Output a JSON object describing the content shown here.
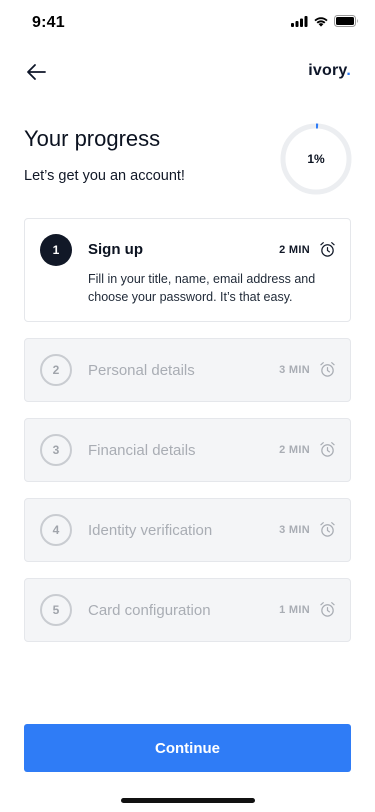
{
  "status_bar": {
    "time": "9:41",
    "icons": [
      "signal-icon",
      "wifi-icon",
      "battery-icon"
    ]
  },
  "header": {
    "back_icon": "arrow-left-icon",
    "brand_name": "ivory",
    "brand_dot": "."
  },
  "progress": {
    "title": "Your progress",
    "subtitle": "Let’s get you an account!",
    "percent_label": "1%",
    "percent_value": 1,
    "accent_color": "#2f7cf6"
  },
  "steps": [
    {
      "number": "1",
      "name": "Sign up",
      "duration": "2 MIN",
      "description": "Fill in your title, name, email address and choose your password. It’s that easy.",
      "state": "active",
      "icon": "alarm-clock-icon"
    },
    {
      "number": "2",
      "name": "Personal details",
      "duration": "3 MIN",
      "state": "locked",
      "icon": "alarm-clock-icon"
    },
    {
      "number": "3",
      "name": "Financial details",
      "duration": "2 MIN",
      "state": "locked",
      "icon": "alarm-clock-icon"
    },
    {
      "number": "4",
      "name": "Identity verification",
      "duration": "3 MIN",
      "state": "locked",
      "icon": "alarm-clock-icon"
    },
    {
      "number": "5",
      "name": "Card configuration",
      "duration": "1 MIN",
      "state": "locked",
      "icon": "alarm-clock-icon"
    }
  ],
  "footer": {
    "continue_label": "Continue",
    "button_color": "#2f7cf6"
  }
}
